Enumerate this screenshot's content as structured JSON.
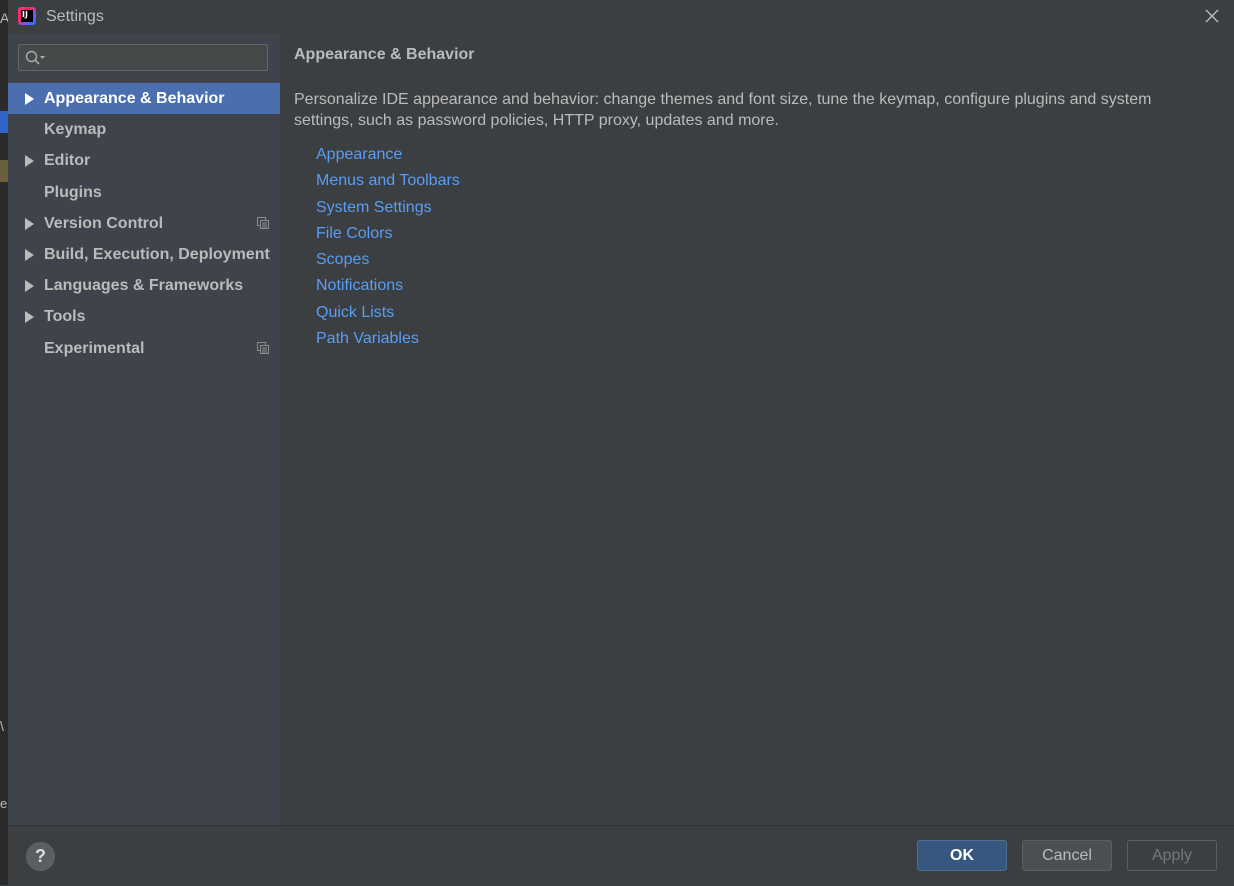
{
  "window": {
    "title": "Settings",
    "app_icon_text": "IJ"
  },
  "search": {
    "value": "",
    "placeholder": ""
  },
  "sidebar": {
    "items": [
      {
        "label": "Appearance & Behavior",
        "expandable": true,
        "selected": true
      },
      {
        "label": "Keymap",
        "expandable": false
      },
      {
        "label": "Editor",
        "expandable": true
      },
      {
        "label": "Plugins",
        "expandable": false
      },
      {
        "label": "Version Control",
        "expandable": true,
        "project_icon": true
      },
      {
        "label": "Build, Execution, Deployment",
        "expandable": true
      },
      {
        "label": "Languages & Frameworks",
        "expandable": true
      },
      {
        "label": "Tools",
        "expandable": true
      },
      {
        "label": "Experimental",
        "expandable": false,
        "project_icon": true
      }
    ]
  },
  "main": {
    "heading": "Appearance & Behavior",
    "description": "Personalize IDE appearance and behavior: change themes and font size, tune the keymap, configure plugins and system settings, such as password policies, HTTP proxy, updates and more.",
    "links": [
      "Appearance",
      "Menus and Toolbars",
      "System Settings",
      "File Colors",
      "Scopes",
      "Notifications",
      "Quick Lists",
      "Path Variables"
    ]
  },
  "footer": {
    "help_label": "?",
    "ok_label": "OK",
    "cancel_label": "Cancel",
    "apply_label": "Apply"
  },
  "background_ide": {
    "fragment_top": "A",
    "fragment_middle": "\\",
    "fragment_bottom": "e"
  },
  "colors": {
    "dialog_bg": "#3c3f41",
    "sidebar_bg": "#3e434c",
    "selection": "#4b6eaf",
    "link": "#589df6",
    "ok_button": "#365880"
  }
}
